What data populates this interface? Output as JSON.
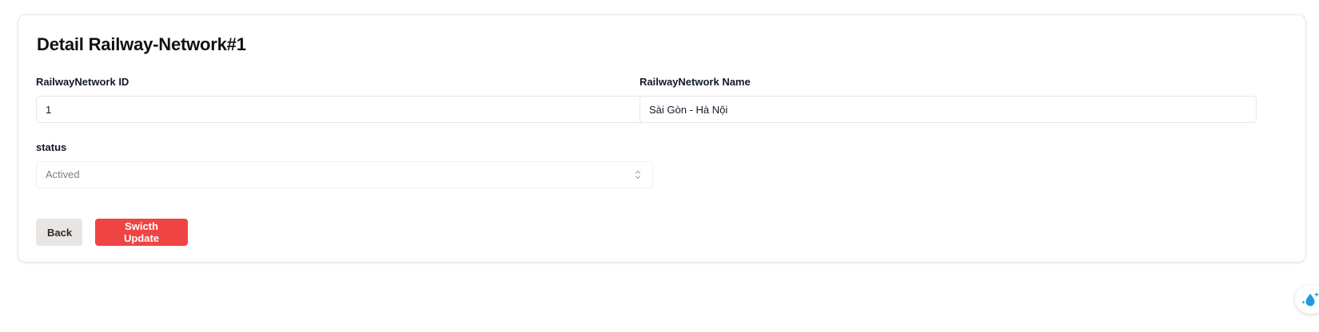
{
  "page": {
    "title": "Detail Railway-Network#1"
  },
  "form": {
    "id_field": {
      "label": "RailwayNetwork ID",
      "value": "1"
    },
    "name_field": {
      "label": "RailwayNetwork Name",
      "value": "Sài Gòn - Hà Nội"
    },
    "status_field": {
      "label": "status",
      "selected": "Actived"
    }
  },
  "actions": {
    "back_label": "Back",
    "update_label": "Swicth Update"
  },
  "colors": {
    "primary_button": "#ef4444",
    "secondary_button": "#e8e5e2",
    "widget_icon": "#1e9be0"
  },
  "widget": {
    "icon": "water-drop-sparkle-icon"
  }
}
